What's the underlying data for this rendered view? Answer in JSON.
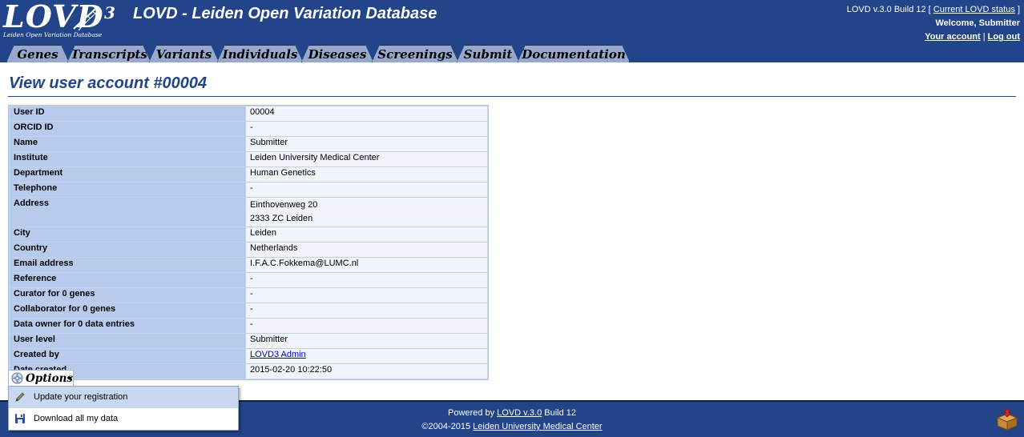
{
  "header": {
    "logo_text": "LOVD",
    "logo_superscript": "3",
    "logo_subtitle": "Leiden Open Variation Database",
    "site_title": "LOVD - Leiden Open Variation Database",
    "version_prefix": "LOVD v.3.0 Build 12 [",
    "status_link": "Current LOVD status",
    "version_suffix": "]",
    "welcome": "Welcome, Submitter",
    "account_link": "Your account",
    "separator": "|",
    "logout_link": "Log out"
  },
  "tabs": [
    {
      "label": "Genes"
    },
    {
      "label": "Transcripts"
    },
    {
      "label": "Variants"
    },
    {
      "label": "Individuals"
    },
    {
      "label": "Diseases"
    },
    {
      "label": "Screenings"
    },
    {
      "label": "Submit"
    },
    {
      "label": "Documentation"
    }
  ],
  "page": {
    "title": "View user account #00004"
  },
  "user_table": [
    {
      "label": "User ID",
      "value": "00004"
    },
    {
      "label": "ORCID ID",
      "value": "-"
    },
    {
      "label": "Name",
      "value": "Submitter"
    },
    {
      "label": "Institute",
      "value": "Leiden University Medical Center"
    },
    {
      "label": "Department",
      "value": "Human Genetics"
    },
    {
      "label": "Telephone",
      "value": "-"
    },
    {
      "label": "Address",
      "value_lines": [
        "Einthovenweg 20",
        "2333 ZC Leiden"
      ]
    },
    {
      "label": "City",
      "value": "Leiden"
    },
    {
      "label": "Country",
      "value": "Netherlands"
    },
    {
      "label": "Email address",
      "value": "I.F.A.C.Fokkema@LUMC.nl"
    },
    {
      "label": "Reference",
      "value": "-"
    },
    {
      "label": "Curator for 0 genes",
      "value": "-"
    },
    {
      "label": "Collaborator for 0 genes",
      "value": "-"
    },
    {
      "label": "Data owner for 0 data entries",
      "value": "-"
    },
    {
      "label": "User level",
      "value": "Submitter"
    },
    {
      "label": "Created by",
      "value": "LOVD3 Admin",
      "is_link": true
    },
    {
      "label": "Date created",
      "value": "2015-02-20 10:22:50"
    }
  ],
  "options": {
    "button_label": "Options",
    "button_icon": "gear-icon",
    "menu": [
      {
        "label": "Update your registration",
        "icon": "pencil-icon",
        "highlighted": true
      },
      {
        "label": "Download all my data",
        "icon": "floppy-disk-icon",
        "highlighted": false
      }
    ]
  },
  "footer": {
    "powered_prefix": "Powered by",
    "powered_link": "LOVD v.3.0",
    "powered_suffix": "Build 12",
    "copyright_prefix": "©2004-2015",
    "copyright_link": "Leiden University Medical Center",
    "icon": "package-download-icon"
  },
  "colors": {
    "header_bg": "#224488",
    "tab_bg": "#97a9cc",
    "table_header_bg": "#b8cbed",
    "table_value_bg": "#f1f4fb",
    "menu_highlight": "#c9d7f1"
  }
}
